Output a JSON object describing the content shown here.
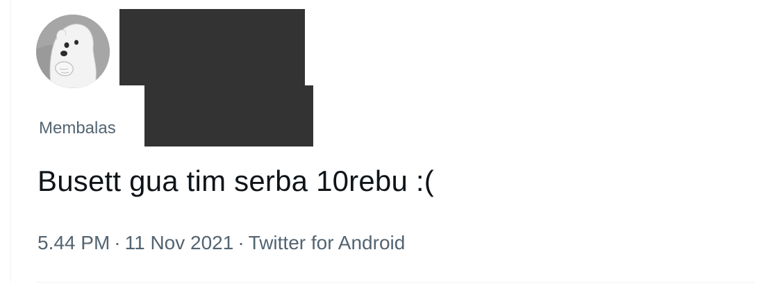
{
  "tweet": {
    "avatar_icon": "polar-bear-avatar-icon",
    "reply_prefix": "Membalas",
    "text": "Busett gua tim serba 10rebu :(",
    "time": "5.44 PM",
    "date": "11 Nov 2021",
    "source": "Twitter for Android",
    "separator": "·"
  },
  "colors": {
    "text_primary": "#0f1419",
    "text_secondary": "#536471",
    "redaction": "#333333",
    "divider": "#eff3f4"
  }
}
